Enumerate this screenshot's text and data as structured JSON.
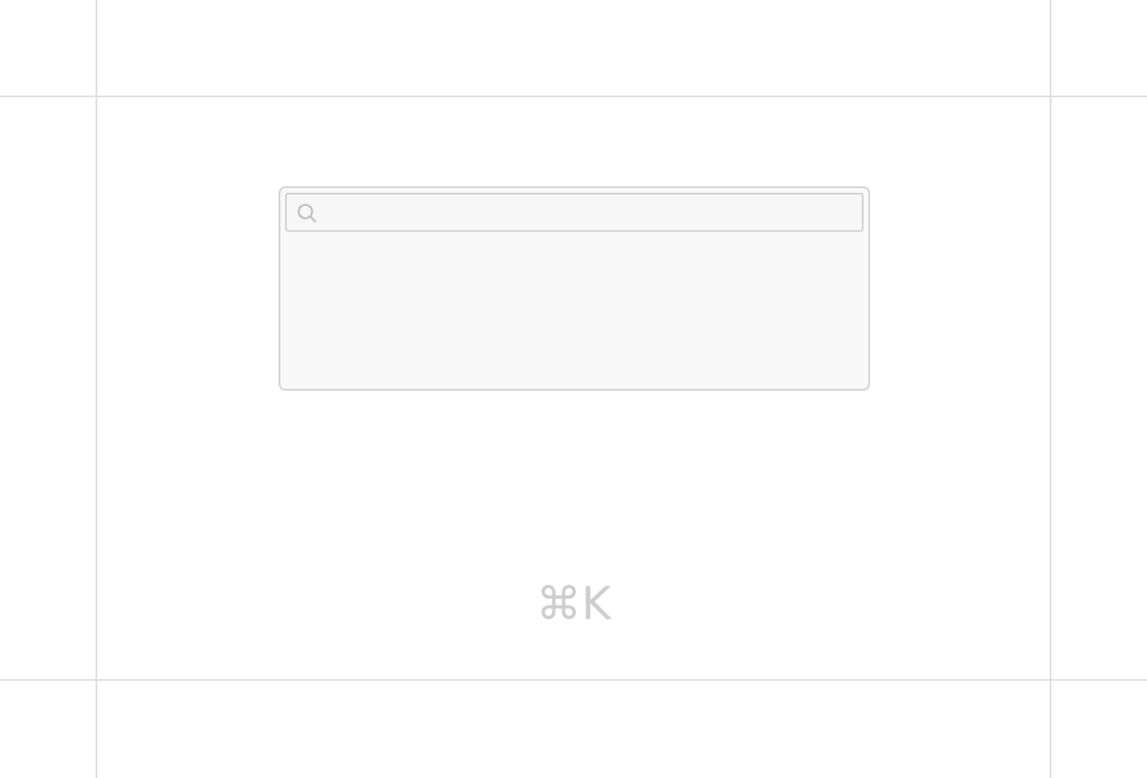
{
  "shortcut": "⌘K"
}
